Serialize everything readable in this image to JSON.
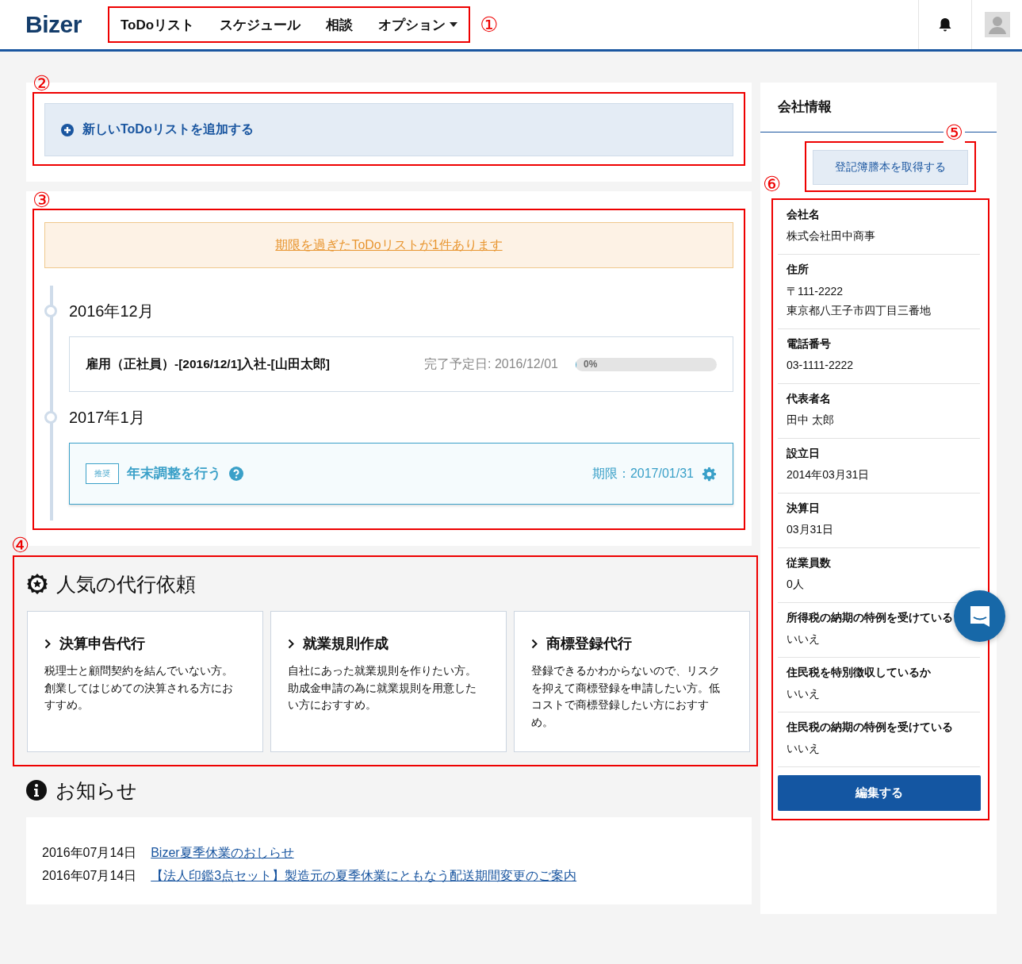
{
  "header": {
    "logo": "Bizer",
    "annotation": "①",
    "nav": [
      {
        "label": "ToDoリスト",
        "dropdown": false
      },
      {
        "label": "スケジュール",
        "dropdown": false
      },
      {
        "label": "相談",
        "dropdown": false
      },
      {
        "label": "オプション",
        "dropdown": true
      }
    ]
  },
  "todo_add": {
    "annotation": "②",
    "label": "新しいToDoリストを追加する"
  },
  "todo_list": {
    "annotation": "③",
    "overdue_alert": "期限を過ぎたToDoリストが1件あります",
    "months": [
      {
        "month": "2016年12月",
        "tasks": [
          {
            "kind": "progress",
            "title": "雇用（正社員）-[2016/12/1]入社-[山田太郎]",
            "due": "完了予定日: 2016/12/01",
            "progress_label": "0%",
            "level": 0
          }
        ]
      },
      {
        "month": "2017年1月",
        "tasks": [
          {
            "kind": "recommended",
            "tag": "推奨",
            "title": "年末調整を行う",
            "due": "期限：2017/01/31"
          }
        ]
      }
    ]
  },
  "popular_services": {
    "annotation": "④",
    "title": "人気の代行依頼",
    "cards": [
      {
        "title": "決算申告代行",
        "description": "税理士と顧問契約を結んでいない方。創業してはじめての決算される方におすすめ。"
      },
      {
        "title": "就業規則作成",
        "description": "自社にあった就業規則を作りたい方。助成金申請の為に就業規則を用意したい方におすすめ。"
      },
      {
        "title": "商標登録代行",
        "description": "登録できるかわからないので、リスクを抑えて商標登録を申請したい方。低コストで商標登録したい方におすすめ。"
      }
    ]
  },
  "news": {
    "title": "お知らせ",
    "items": [
      {
        "date": "2016年07月14日",
        "title": "Bizer夏季休業のおしらせ"
      },
      {
        "date": "2016年07月14日",
        "title": "【法人印鑑3点セット】製造元の夏季休業にともなう配送期間変更のご案内"
      }
    ]
  },
  "company_info": {
    "title": "会社情報",
    "register_button": {
      "annotation": "⑤",
      "label": "登記簿謄本を取得する"
    },
    "annotation": "⑥",
    "fields": [
      {
        "label": "会社名",
        "value": "株式会社田中商事"
      },
      {
        "label": "住所",
        "value": "〒111-2222\n東京都八王子市四丁目三番地"
      },
      {
        "label": "電話番号",
        "value": "03-1111-2222"
      },
      {
        "label": "代表者名",
        "value": "田中 太郎"
      },
      {
        "label": "設立日",
        "value": "2014年03月31日"
      },
      {
        "label": "決算日",
        "value": "03月31日"
      },
      {
        "label": "従業員数",
        "value": "0人"
      },
      {
        "label": "所得税の納期の特例を受けている",
        "value": "いいえ"
      },
      {
        "label": "住民税を特別徴収しているか",
        "value": "いいえ"
      },
      {
        "label": "住民税の納期の特例を受けている",
        "value": "いいえ"
      }
    ],
    "edit_button": "編集する"
  }
}
